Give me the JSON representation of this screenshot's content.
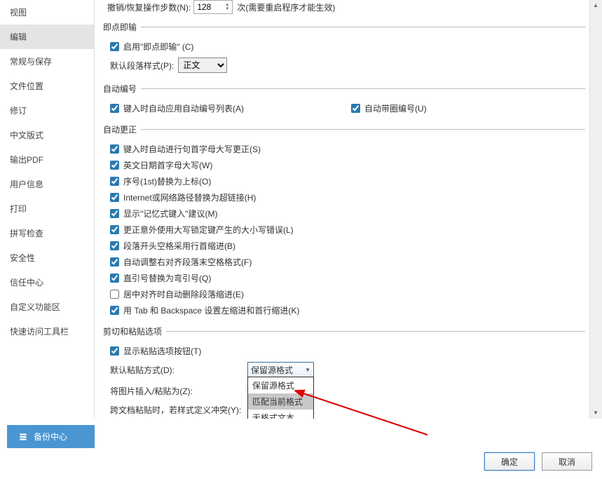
{
  "sidebar": {
    "items": [
      {
        "label": "视图"
      },
      {
        "label": "编辑"
      },
      {
        "label": "常规与保存"
      },
      {
        "label": "文件位置"
      },
      {
        "label": "修订"
      },
      {
        "label": "中文版式"
      },
      {
        "label": "输出PDF"
      },
      {
        "label": "用户信息"
      },
      {
        "label": "打印"
      },
      {
        "label": "拼写检查"
      },
      {
        "label": "安全性"
      },
      {
        "label": "信任中心"
      },
      {
        "label": "自定义功能区"
      },
      {
        "label": "快速访问工具栏"
      }
    ],
    "active_index": 1
  },
  "undo": {
    "label_before": "撤销/恢复操作步数(N):",
    "value": "128",
    "label_after": "次(需要重启程序才能生效)"
  },
  "groups": {
    "click_type": {
      "title": "即点即输",
      "enable": {
        "checked": true,
        "label": "启用\"即点即输\" (C)"
      },
      "para_label": "默认段落样式(P):",
      "para_value": "正文"
    },
    "auto_number": {
      "title": "自动编号",
      "apply_list": {
        "checked": true,
        "label": "键入时自动应用自动编号列表(A)"
      },
      "circle_num": {
        "checked": true,
        "label": "自动带圈编号(U)"
      }
    },
    "auto_correct": {
      "title": "自动更正",
      "items": [
        {
          "checked": true,
          "label": "键入时自动进行句首字母大写更正(S)"
        },
        {
          "checked": true,
          "label": "英文日期首字母大写(W)"
        },
        {
          "checked": true,
          "label": "序号(1st)替换为上标(O)"
        },
        {
          "checked": true,
          "label": "Internet或网络路径替换为超链接(H)"
        },
        {
          "checked": true,
          "label": "显示\"记忆式键入\"建议(M)"
        },
        {
          "checked": true,
          "label": "更正意外使用大写锁定键产生的大小写错误(L)"
        },
        {
          "checked": true,
          "label": "段落开头空格采用行首缩进(B)"
        },
        {
          "checked": true,
          "label": "自动调整右对齐段落末空格格式(F)"
        },
        {
          "checked": true,
          "label": "直引号替换为弯引号(Q)"
        },
        {
          "checked": false,
          "label": "居中对齐时自动删除段落缩进(E)"
        },
        {
          "checked": true,
          "label": "用 Tab 和 Backspace 设置左缩进和首行缩进(K)"
        }
      ]
    },
    "cut_paste": {
      "title": "剪切和粘贴选项",
      "show_btn": {
        "checked": true,
        "label": "显示粘贴选项按钮(T)"
      },
      "default_paste_label": "默认粘贴方式(D):",
      "default_paste_value": "保留源格式",
      "default_paste_options": [
        "保留源格式",
        "匹配当前格式",
        "无格式文本"
      ],
      "insert_img_label": "将图片插入/粘贴为(Z):",
      "cross_doc_label": "跨文档粘贴时，若样式定义冲突(Y):"
    }
  },
  "backup_center": "备份中心",
  "buttons": {
    "ok": "确定",
    "cancel": "取消"
  }
}
